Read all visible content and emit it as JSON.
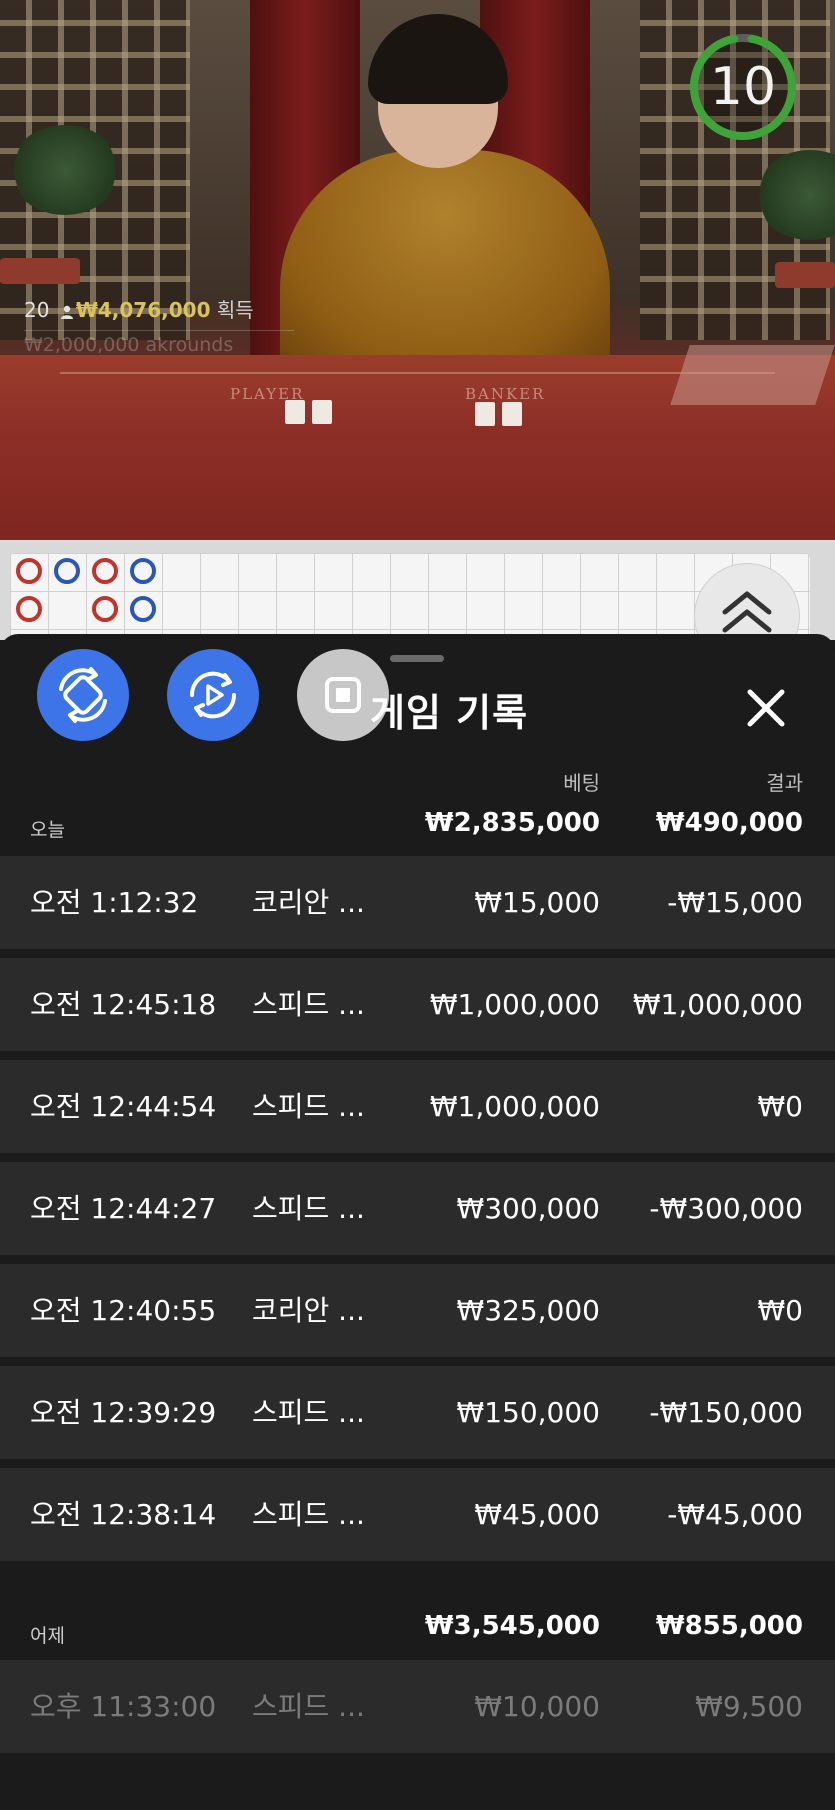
{
  "video": {
    "timer": "10",
    "players": {
      "count": "20",
      "amount": "₩4,076,000",
      "suffix": "획득"
    },
    "faded_text": "₩2,000,000 akrounds",
    "table_labels": {
      "player": "PLAYER",
      "banker": "BANKER"
    }
  },
  "roadmap": [
    [
      "red",
      "blue",
      "red",
      "blue"
    ],
    [
      "red",
      "",
      "red",
      "blue"
    ]
  ],
  "actions": [
    {
      "name": "rotate-bet-icon"
    },
    {
      "name": "replay-icon"
    },
    {
      "name": "stop-icon"
    }
  ],
  "history": {
    "title": "게임 기록",
    "columns": {
      "bet": "베팅",
      "result": "결과"
    },
    "today": {
      "label": "오늘",
      "total_bet": "₩2,835,000",
      "total_result": "₩490,000",
      "rows": [
        {
          "time": "오전 1:12:32",
          "game": "코리안 ...",
          "bet": "₩15,000",
          "result": "-₩15,000"
        },
        {
          "time": "오전 12:45:18",
          "game": "스피드 ...",
          "bet": "₩1,000,000",
          "result": "₩1,000,000"
        },
        {
          "time": "오전 12:44:54",
          "game": "스피드 ...",
          "bet": "₩1,000,000",
          "result": "₩0"
        },
        {
          "time": "오전 12:44:27",
          "game": "스피드 ...",
          "bet": "₩300,000",
          "result": "-₩300,000"
        },
        {
          "time": "오전 12:40:55",
          "game": "코리안 ...",
          "bet": "₩325,000",
          "result": "₩0"
        },
        {
          "time": "오전 12:39:29",
          "game": "스피드 ...",
          "bet": "₩150,000",
          "result": "-₩150,000"
        },
        {
          "time": "오전 12:38:14",
          "game": "스피드 ...",
          "bet": "₩45,000",
          "result": "-₩45,000"
        }
      ]
    },
    "yesterday": {
      "label": "어제",
      "total_bet": "₩3,545,000",
      "total_result": "₩855,000",
      "rows": [
        {
          "time": "오후 11:33:00",
          "game": "스피드 ...",
          "bet": "₩10,000",
          "result": "₩9,500"
        }
      ]
    }
  }
}
